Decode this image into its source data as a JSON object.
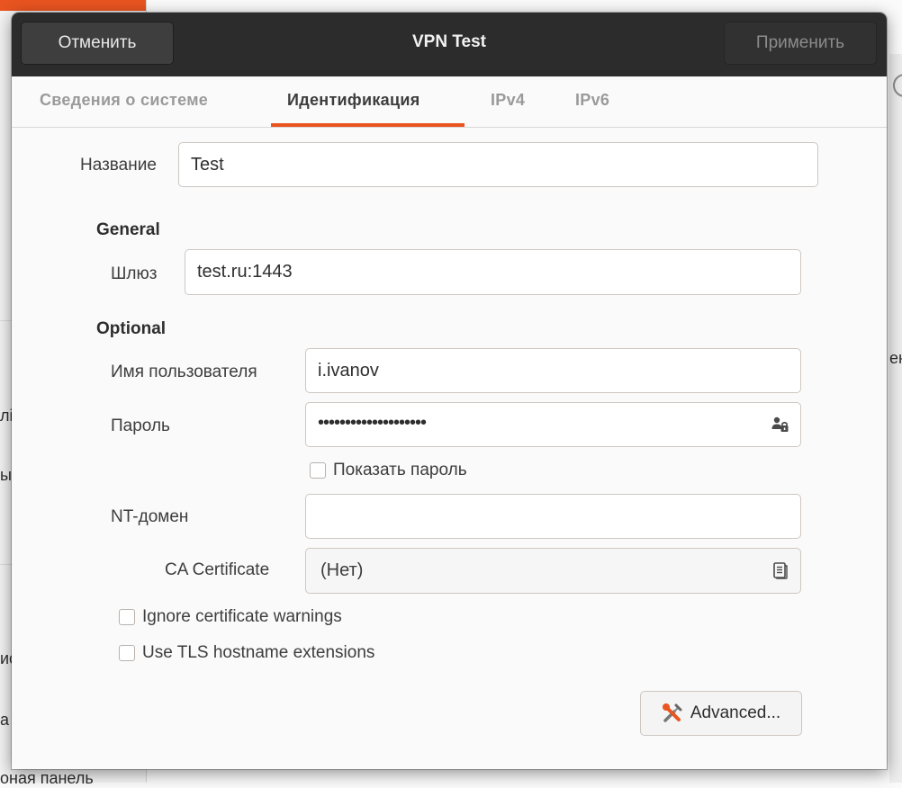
{
  "dialog": {
    "title": "VPN Test",
    "cancel_label": "Отменить",
    "apply_label": "Применить"
  },
  "tabs": [
    {
      "label": "Сведения о системе",
      "active": false
    },
    {
      "label": "Идентификация",
      "active": true
    },
    {
      "label": "IPv4",
      "active": false
    },
    {
      "label": "IPv6",
      "active": false
    }
  ],
  "form": {
    "name_label": "Название",
    "name_value": "Test",
    "general_heading": "General",
    "gateway_label": "Шлюз",
    "gateway_value": "test.ru:1443",
    "optional_heading": "Optional",
    "username_label": "Имя пользователя",
    "username_value": "i.ivanov",
    "password_label": "Пароль",
    "password_value": "••••••••••••••••••••",
    "password_icon": "user-lock-icon",
    "show_password_label": "Показать пароль",
    "show_password_checked": false,
    "nt_domain_label": "NT-домен",
    "nt_domain_value": "",
    "ca_label": "CA Certificate",
    "ca_value": "(Нет)",
    "ca_icon": "document-icon",
    "ignore_cert_label": "Ignore certificate warnings",
    "ignore_cert_checked": false,
    "tls_label": "Use TLS hostname extensions",
    "tls_checked": false,
    "advanced_label": "Advanced..."
  },
  "background": {
    "frag1": "лі",
    "frag2": "ы",
    "frag3": "ис",
    "frag4": "а",
    "frag5": "оная панель",
    "frag6": "ен"
  },
  "colors": {
    "accent": "#e95420",
    "headerbar": "#2c2c2c"
  }
}
